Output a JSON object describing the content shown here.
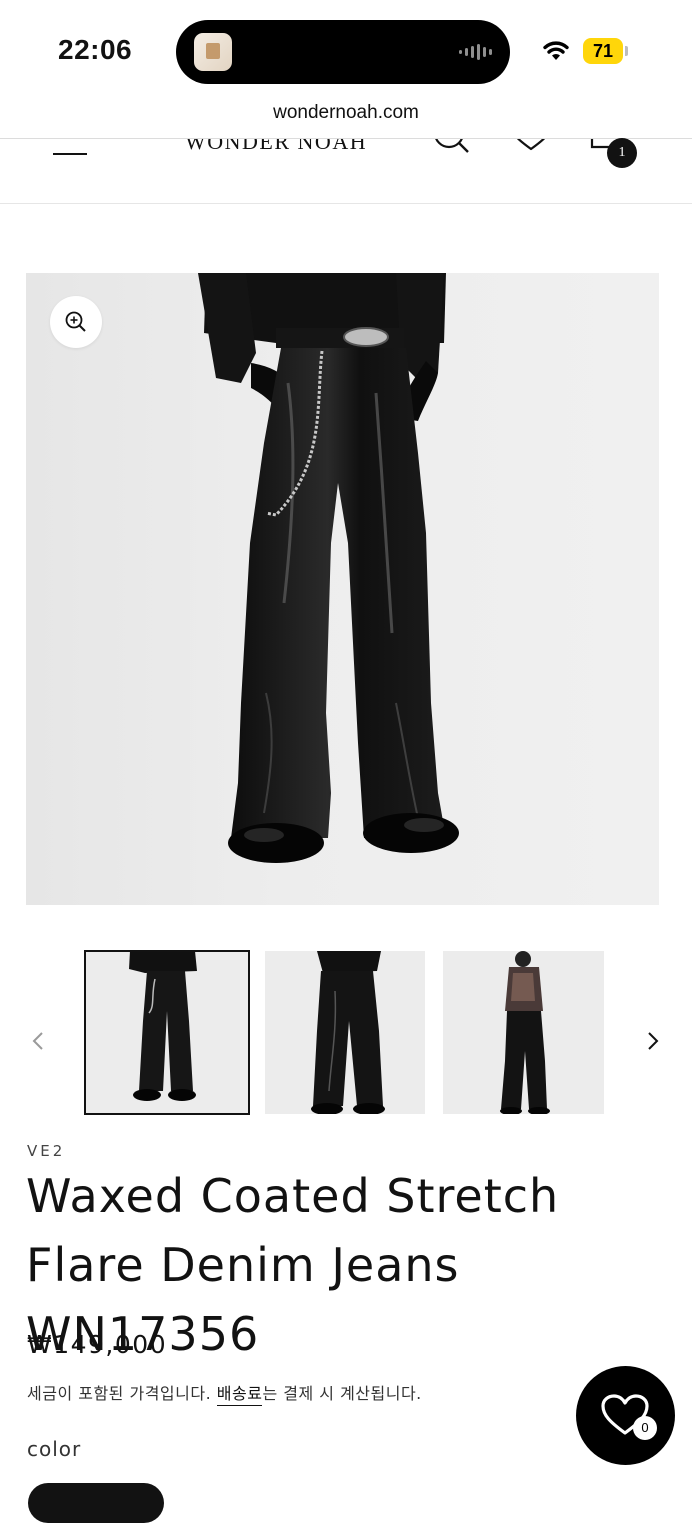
{
  "status_bar": {
    "time": "22:06",
    "battery": "71"
  },
  "browser": {
    "url": "wondernoah.com"
  },
  "header": {
    "logo": "WONDER NOAH",
    "cart_count": "1"
  },
  "product": {
    "vendor": "VE2",
    "title": "Waxed Coated Stretch Flare Denim Jeans WN17356",
    "price": "₩149,000",
    "tax_note_prefix": "세금이 포함된 가격입니다. ",
    "shipping_link": "배송료",
    "tax_note_suffix": "는 결제 시 계산됩니다.",
    "color_label": "color"
  },
  "gallery": {
    "thumbnail_count": 3,
    "active_index": 0
  },
  "wishlist": {
    "count": "0"
  },
  "colors": {
    "text": "#121212",
    "battery": "#ffd60a"
  }
}
